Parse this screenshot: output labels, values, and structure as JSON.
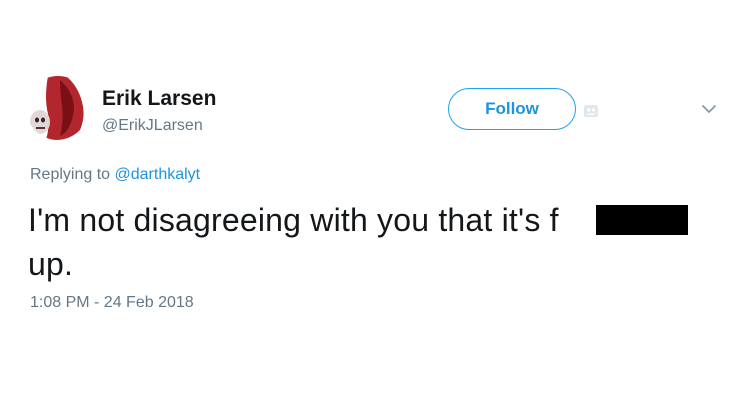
{
  "user": {
    "name": "Erik Larsen",
    "handle": "@ErikJLarsen"
  },
  "follow_button": {
    "label": "Follow"
  },
  "icons": {
    "bot": "bot-badge-icon",
    "more": "chevron-down-icon"
  },
  "reply": {
    "prefix": "Replying to",
    "mention": "@darthkalyt"
  },
  "tweet": {
    "text": "I'm not disagreeing with you that it's f\nup.",
    "timestamp": "1:08 PM - 24 Feb 2018"
  },
  "colors": {
    "link": "#1b95e0",
    "follow_border": "#1da1f2",
    "secondary_text": "#657786",
    "primary_text": "#14171a",
    "redaction": "#000000"
  }
}
